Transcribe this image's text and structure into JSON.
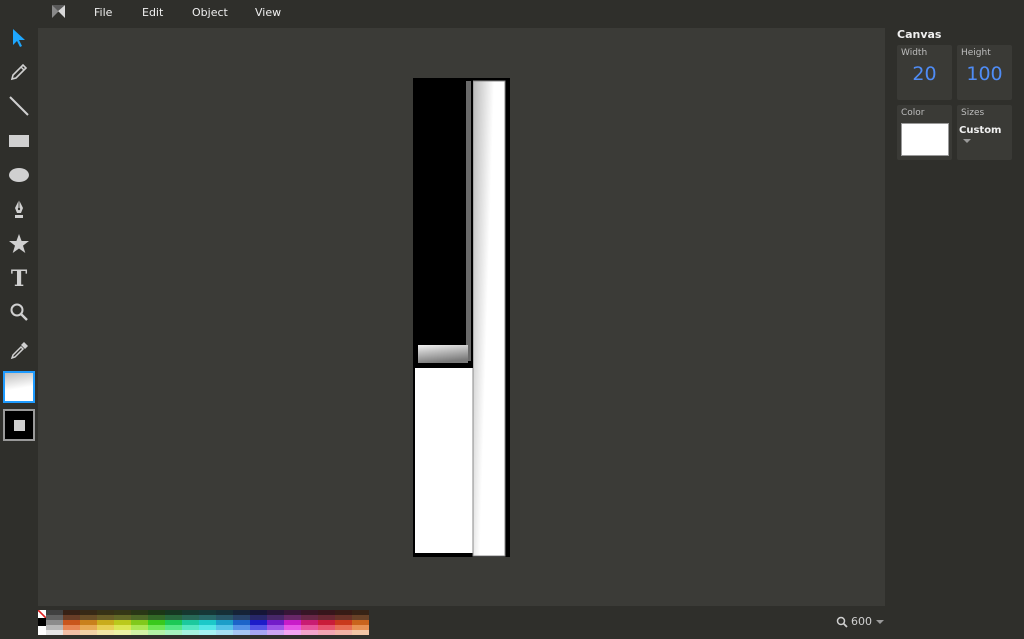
{
  "menu": {
    "logo": "method-draw-logo",
    "items": [
      "File",
      "Edit",
      "Object",
      "View"
    ]
  },
  "tools": [
    {
      "name": "select",
      "icon": "cursor-arrow-icon",
      "active": true
    },
    {
      "name": "pencil",
      "icon": "pencil-icon"
    },
    {
      "name": "line",
      "icon": "line-icon"
    },
    {
      "name": "rectangle",
      "icon": "rectangle-icon"
    },
    {
      "name": "ellipse",
      "icon": "ellipse-icon"
    },
    {
      "name": "path",
      "icon": "pen-nib-icon"
    },
    {
      "name": "star",
      "icon": "star-icon"
    },
    {
      "name": "text",
      "icon": "text-icon"
    },
    {
      "name": "zoom",
      "icon": "magnifier-icon"
    },
    {
      "name": "eyedropper",
      "icon": "eyedropper-icon"
    }
  ],
  "swatches": {
    "fill": "gradient-white",
    "stroke": "#000000"
  },
  "panel": {
    "title": "Canvas",
    "width_label": "Width",
    "width_value": "20",
    "height_label": "Height",
    "height_value": "100",
    "color_label": "Color",
    "color_value": "#ffffff",
    "sizes_label": "Sizes",
    "sizes_value": "Custom"
  },
  "zoom": {
    "value": "600"
  },
  "colors": {
    "accent": "#1e9bff",
    "value_blue": "#4f8cf6",
    "workarea": "#3b3b37",
    "chrome": "#2f2f2b"
  }
}
